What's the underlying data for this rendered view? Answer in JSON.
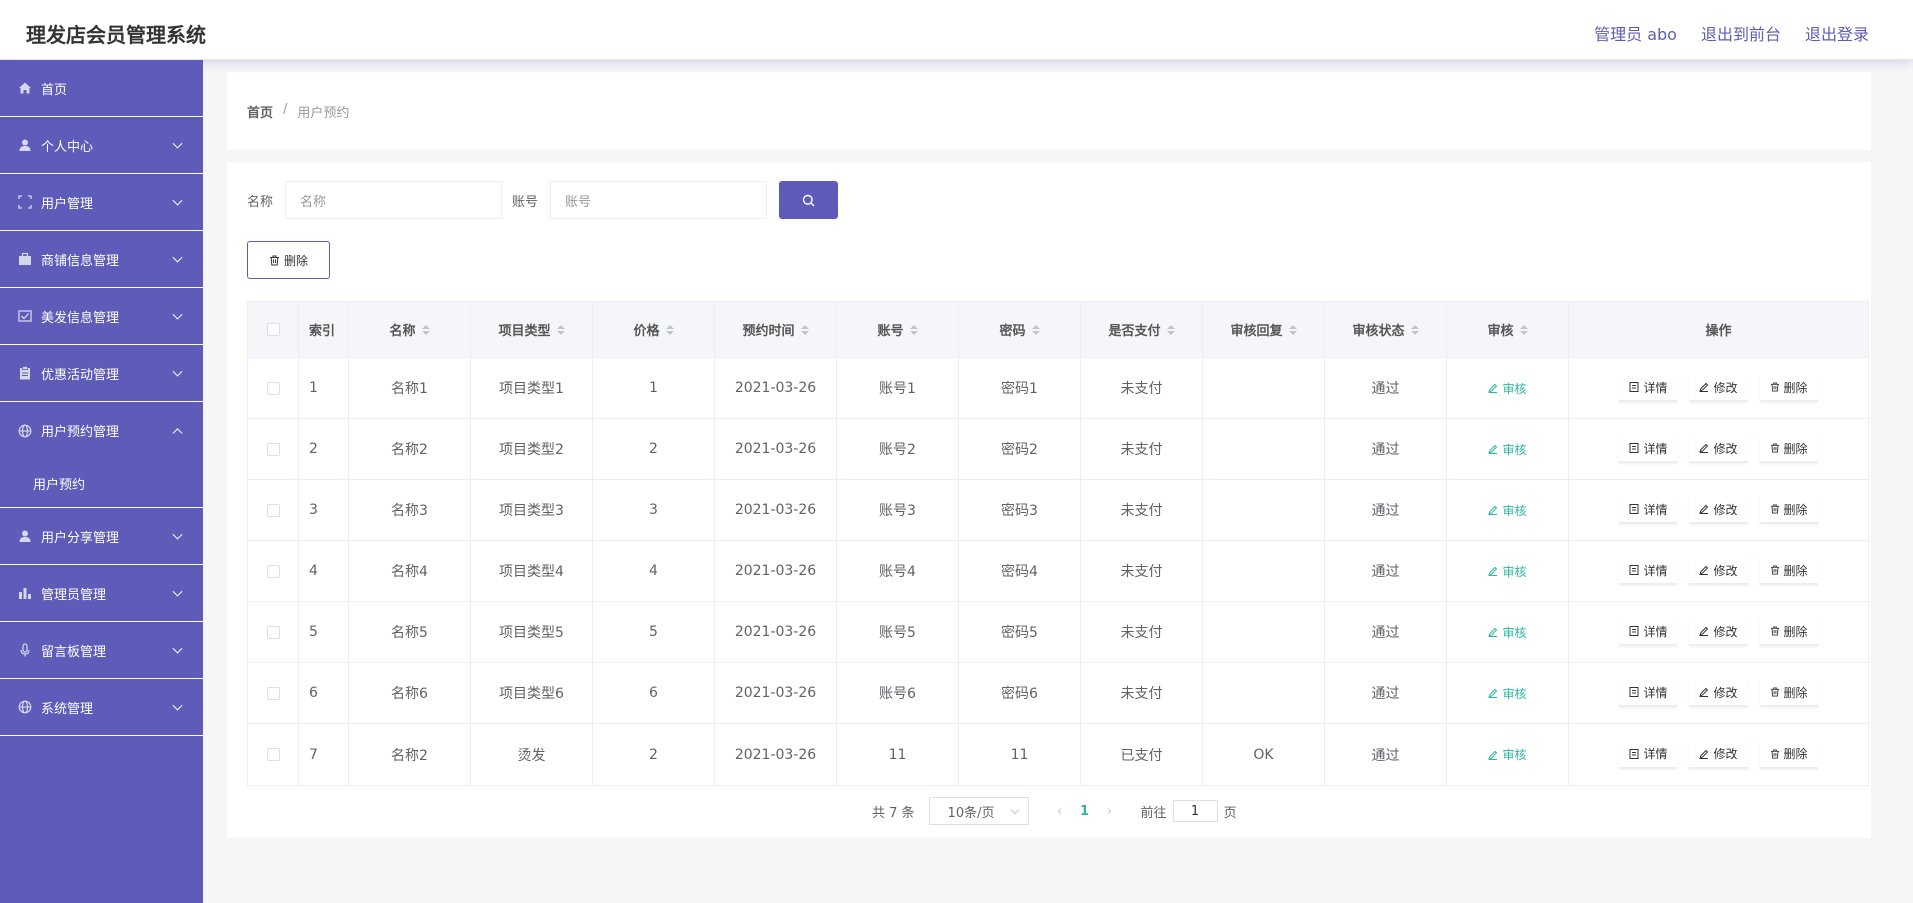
{
  "header": {
    "title": "理发店会员管理系统",
    "user": "管理员 abo",
    "to_front": "退出到前台",
    "logout": "退出登录"
  },
  "sidebar": {
    "items": [
      {
        "label": "首页",
        "icon": "home-icon"
      },
      {
        "label": "个人中心",
        "icon": "user-icon"
      },
      {
        "label": "用户管理",
        "icon": "scan-icon"
      },
      {
        "label": "商铺信息管理",
        "icon": "briefcase-icon"
      },
      {
        "label": "美发信息管理",
        "icon": "checkbox-icon"
      },
      {
        "label": "优惠活动管理",
        "icon": "clipboard-icon"
      },
      {
        "label": "用户预约管理",
        "icon": "globe-icon"
      },
      {
        "label": "用户分享管理",
        "icon": "user-icon"
      },
      {
        "label": "管理员管理",
        "icon": "bar-chart-icon"
      },
      {
        "label": "留言板管理",
        "icon": "microphone-icon"
      },
      {
        "label": "系统管理",
        "icon": "globe-icon"
      }
    ],
    "submenu": "用户预约"
  },
  "breadcrumb": {
    "home": "首页",
    "sep": "/",
    "current": "用户预约"
  },
  "search": {
    "name_label": "名称",
    "name_placeholder": "名称",
    "account_label": "账号",
    "account_placeholder": "账号"
  },
  "toolbar": {
    "delete_label": "删除"
  },
  "table": {
    "headers": [
      "索引",
      "名称",
      "项目类型",
      "价格",
      "预约时间",
      "账号",
      "密码",
      "是否支付",
      "审核回复",
      "审核状态",
      "审核",
      "操作"
    ],
    "rows": [
      [
        "1",
        "名称1",
        "项目类型1",
        "1",
        "2021-03-26",
        "账号1",
        "密码1",
        "未支付",
        "",
        "通过"
      ],
      [
        "2",
        "名称2",
        "项目类型2",
        "2",
        "2021-03-26",
        "账号2",
        "密码2",
        "未支付",
        "",
        "通过"
      ],
      [
        "3",
        "名称3",
        "项目类型3",
        "3",
        "2021-03-26",
        "账号3",
        "密码3",
        "未支付",
        "",
        "通过"
      ],
      [
        "4",
        "名称4",
        "项目类型4",
        "4",
        "2021-03-26",
        "账号4",
        "密码4",
        "未支付",
        "",
        "通过"
      ],
      [
        "5",
        "名称5",
        "项目类型5",
        "5",
        "2021-03-26",
        "账号5",
        "密码5",
        "未支付",
        "",
        "通过"
      ],
      [
        "6",
        "名称6",
        "项目类型6",
        "6",
        "2021-03-26",
        "账号6",
        "密码6",
        "未支付",
        "",
        "通过"
      ],
      [
        "7",
        "名称2",
        "烫发",
        "2",
        "2021-03-26",
        "11",
        "11",
        "已支付",
        "OK",
        "通过"
      ]
    ],
    "audit_label": "审核",
    "ops": {
      "detail": "详情",
      "edit": "修改",
      "delete": "删除"
    }
  },
  "pagination": {
    "total": "共 7 条",
    "page_size": "10条/页",
    "current_page": "1",
    "goto_label": "前往",
    "goto_value": "1",
    "page_unit": "页"
  },
  "colors": {
    "primary": "#5e5cb8",
    "accent": "#2db7a0"
  }
}
